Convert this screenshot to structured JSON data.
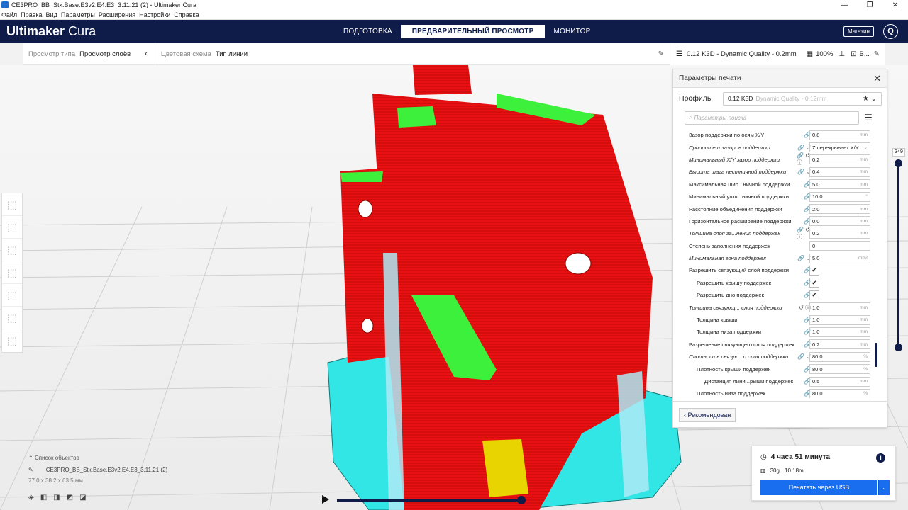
{
  "window": {
    "title": "CE3PRO_BB_Stk.Base.E3v2.E4.E3_3.11.21 (2) - Ultimaker Cura",
    "controls": [
      "—",
      "❐",
      "✕"
    ]
  },
  "menu": [
    "Файл",
    "Правка",
    "Вид",
    "Параметры",
    "Расширения",
    "Настройки",
    "Справка"
  ],
  "header": {
    "logo_main": "Ultimaker",
    "logo_sub": "Cura",
    "stages": [
      "ПОДГОТОВКА",
      "ПРЕДВАРИТЕЛЬНЫЙ ПРОСМОТР",
      "МОНИТОР"
    ],
    "active_stage": 1,
    "marketplace": "Магазин",
    "account": "Q"
  },
  "viewbar": {
    "view_type_label": "Просмотр типа",
    "view_type_value": "Просмотр слоёв",
    "color_scheme_label": "Цветовая схема",
    "color_scheme_value": "Тип линии"
  },
  "printbar": {
    "profile": "0.12 K3D - Dynamic Quality - 0.2mm",
    "infill": "100%",
    "extra": "В..."
  },
  "settings": {
    "title": "Параметры печати",
    "profile_label": "Профиль",
    "profile_value": "0.12 K3D",
    "profile_sub": "Dynamic Quality - 0.12mm",
    "search_placeholder": "Параметры поиска",
    "recommended": "Рекомендован",
    "rows": [
      {
        "name": "Зазор поддержки по осям X/Y",
        "indent": 0,
        "italic": false,
        "icons": "🔗",
        "value": "0.8",
        "unit": "mm"
      },
      {
        "name": "Приоритет зазоров поддержки",
        "indent": 0,
        "italic": true,
        "icons": "🔗 ↺",
        "value": "Z перекрывает X/Y",
        "unit": "⌄"
      },
      {
        "name": "Минимальный X/Y зазор поддержки",
        "indent": 0,
        "italic": true,
        "icons": "🔗 ↺ ⓘ",
        "value": "0.2",
        "unit": "mm"
      },
      {
        "name": "Высота шага лестничной поддержки",
        "indent": 0,
        "italic": true,
        "icons": "🔗 ↺",
        "value": "0.4",
        "unit": "mm"
      },
      {
        "name": "Максимальная шир...ничной поддержки",
        "indent": 0,
        "italic": false,
        "icons": "🔗",
        "value": "5.0",
        "unit": "mm"
      },
      {
        "name": "Минимальный угол...ничной поддержки",
        "indent": 0,
        "italic": false,
        "icons": "🔗",
        "value": "10.0",
        "unit": "°"
      },
      {
        "name": "Расстояние объединения поддержки",
        "indent": 0,
        "italic": false,
        "icons": "🔗",
        "value": "2.0",
        "unit": "mm"
      },
      {
        "name": "Горизонтальное расширение поддержки",
        "indent": 0,
        "italic": false,
        "icons": "🔗",
        "value": "0.0",
        "unit": "mm"
      },
      {
        "name": "Толщина слоя за...нения поддержек",
        "indent": 0,
        "italic": true,
        "icons": "🔗 ↺ ⓘ",
        "value": "0.2",
        "unit": "mm"
      },
      {
        "name": "Степень заполнения поддержек",
        "indent": 0,
        "italic": false,
        "icons": "",
        "value": "0",
        "unit": ""
      },
      {
        "name": "Минимальная зона поддержек",
        "indent": 0,
        "italic": true,
        "icons": "🔗 ↺",
        "value": "5.0",
        "unit": "mm²"
      },
      {
        "name": "Разрешить связующий слой поддержки",
        "indent": 0,
        "italic": false,
        "icons": "🔗",
        "check": "✔"
      },
      {
        "name": "Разрешить крышу поддержек",
        "indent": 1,
        "italic": false,
        "icons": "🔗",
        "check": "✔"
      },
      {
        "name": "Разрешить дно поддержек",
        "indent": 1,
        "italic": false,
        "icons": "🔗",
        "check": "✔"
      },
      {
        "name": "Толщина связующ... слоя поддержки",
        "indent": 0,
        "italic": true,
        "icons": "↺ ⓘ",
        "value": "1.0",
        "unit": "mm"
      },
      {
        "name": "Толщина крыши",
        "indent": 1,
        "italic": false,
        "icons": "🔗",
        "value": "1.0",
        "unit": "mm"
      },
      {
        "name": "Толщина низа поддержки",
        "indent": 1,
        "italic": false,
        "icons": "🔗",
        "value": "1.0",
        "unit": "mm"
      },
      {
        "name": "Разрешение связующего слоя поддержек",
        "indent": 0,
        "italic": false,
        "icons": "🔗",
        "value": "0.2",
        "unit": "mm"
      },
      {
        "name": "Плотность связую...о слоя поддержки",
        "indent": 0,
        "italic": true,
        "icons": "🔗 ↺",
        "value": "80.0",
        "unit": "%"
      },
      {
        "name": "Плотность крыши поддержек",
        "indent": 1,
        "italic": false,
        "icons": "🔗",
        "value": "80.0",
        "unit": "%"
      },
      {
        "name": "Дистанция лини...рыши поддержек",
        "indent": 2,
        "italic": false,
        "icons": "🔗",
        "value": "0.5",
        "unit": "mm"
      },
      {
        "name": "Плотность низа поддержек",
        "indent": 1,
        "italic": false,
        "icons": "🔗",
        "value": "80.0",
        "unit": "%"
      }
    ]
  },
  "layer_slider": {
    "value": "349"
  },
  "objects": {
    "header": "Список объектов",
    "name": "CE3PRO_BB_Stk.Base.E3v2.E4.E3_3.11.21 (2)",
    "dims": "77.0 x 38.2 x 63.5 мм"
  },
  "job": {
    "time": "4 часа 51 минута",
    "material": "30g · 10.18m",
    "button": "Печатать через USB"
  },
  "colors": {
    "header": "#0f1c4a",
    "accent": "#196ef0",
    "model": "#e81010",
    "support": "#33e6e6",
    "top": "#3cf03c"
  }
}
